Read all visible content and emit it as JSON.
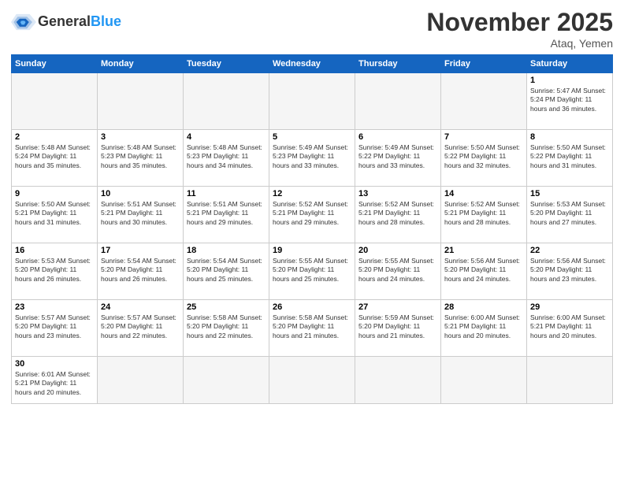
{
  "header": {
    "logo_general": "General",
    "logo_blue": "Blue",
    "month_title": "November 2025",
    "location": "Ataq, Yemen"
  },
  "days_of_week": [
    "Sunday",
    "Monday",
    "Tuesday",
    "Wednesday",
    "Thursday",
    "Friday",
    "Saturday"
  ],
  "weeks": [
    [
      {
        "day": "",
        "info": ""
      },
      {
        "day": "",
        "info": ""
      },
      {
        "day": "",
        "info": ""
      },
      {
        "day": "",
        "info": ""
      },
      {
        "day": "",
        "info": ""
      },
      {
        "day": "",
        "info": ""
      },
      {
        "day": "1",
        "info": "Sunrise: 5:47 AM\nSunset: 5:24 PM\nDaylight: 11 hours\nand 36 minutes."
      }
    ],
    [
      {
        "day": "2",
        "info": "Sunrise: 5:48 AM\nSunset: 5:24 PM\nDaylight: 11 hours\nand 35 minutes."
      },
      {
        "day": "3",
        "info": "Sunrise: 5:48 AM\nSunset: 5:23 PM\nDaylight: 11 hours\nand 35 minutes."
      },
      {
        "day": "4",
        "info": "Sunrise: 5:48 AM\nSunset: 5:23 PM\nDaylight: 11 hours\nand 34 minutes."
      },
      {
        "day": "5",
        "info": "Sunrise: 5:49 AM\nSunset: 5:23 PM\nDaylight: 11 hours\nand 33 minutes."
      },
      {
        "day": "6",
        "info": "Sunrise: 5:49 AM\nSunset: 5:22 PM\nDaylight: 11 hours\nand 33 minutes."
      },
      {
        "day": "7",
        "info": "Sunrise: 5:50 AM\nSunset: 5:22 PM\nDaylight: 11 hours\nand 32 minutes."
      },
      {
        "day": "8",
        "info": "Sunrise: 5:50 AM\nSunset: 5:22 PM\nDaylight: 11 hours\nand 31 minutes."
      }
    ],
    [
      {
        "day": "9",
        "info": "Sunrise: 5:50 AM\nSunset: 5:21 PM\nDaylight: 11 hours\nand 31 minutes."
      },
      {
        "day": "10",
        "info": "Sunrise: 5:51 AM\nSunset: 5:21 PM\nDaylight: 11 hours\nand 30 minutes."
      },
      {
        "day": "11",
        "info": "Sunrise: 5:51 AM\nSunset: 5:21 PM\nDaylight: 11 hours\nand 29 minutes."
      },
      {
        "day": "12",
        "info": "Sunrise: 5:52 AM\nSunset: 5:21 PM\nDaylight: 11 hours\nand 29 minutes."
      },
      {
        "day": "13",
        "info": "Sunrise: 5:52 AM\nSunset: 5:21 PM\nDaylight: 11 hours\nand 28 minutes."
      },
      {
        "day": "14",
        "info": "Sunrise: 5:52 AM\nSunset: 5:21 PM\nDaylight: 11 hours\nand 28 minutes."
      },
      {
        "day": "15",
        "info": "Sunrise: 5:53 AM\nSunset: 5:20 PM\nDaylight: 11 hours\nand 27 minutes."
      }
    ],
    [
      {
        "day": "16",
        "info": "Sunrise: 5:53 AM\nSunset: 5:20 PM\nDaylight: 11 hours\nand 26 minutes."
      },
      {
        "day": "17",
        "info": "Sunrise: 5:54 AM\nSunset: 5:20 PM\nDaylight: 11 hours\nand 26 minutes."
      },
      {
        "day": "18",
        "info": "Sunrise: 5:54 AM\nSunset: 5:20 PM\nDaylight: 11 hours\nand 25 minutes."
      },
      {
        "day": "19",
        "info": "Sunrise: 5:55 AM\nSunset: 5:20 PM\nDaylight: 11 hours\nand 25 minutes."
      },
      {
        "day": "20",
        "info": "Sunrise: 5:55 AM\nSunset: 5:20 PM\nDaylight: 11 hours\nand 24 minutes."
      },
      {
        "day": "21",
        "info": "Sunrise: 5:56 AM\nSunset: 5:20 PM\nDaylight: 11 hours\nand 24 minutes."
      },
      {
        "day": "22",
        "info": "Sunrise: 5:56 AM\nSunset: 5:20 PM\nDaylight: 11 hours\nand 23 minutes."
      }
    ],
    [
      {
        "day": "23",
        "info": "Sunrise: 5:57 AM\nSunset: 5:20 PM\nDaylight: 11 hours\nand 23 minutes."
      },
      {
        "day": "24",
        "info": "Sunrise: 5:57 AM\nSunset: 5:20 PM\nDaylight: 11 hours\nand 22 minutes."
      },
      {
        "day": "25",
        "info": "Sunrise: 5:58 AM\nSunset: 5:20 PM\nDaylight: 11 hours\nand 22 minutes."
      },
      {
        "day": "26",
        "info": "Sunrise: 5:58 AM\nSunset: 5:20 PM\nDaylight: 11 hours\nand 21 minutes."
      },
      {
        "day": "27",
        "info": "Sunrise: 5:59 AM\nSunset: 5:20 PM\nDaylight: 11 hours\nand 21 minutes."
      },
      {
        "day": "28",
        "info": "Sunrise: 6:00 AM\nSunset: 5:21 PM\nDaylight: 11 hours\nand 20 minutes."
      },
      {
        "day": "29",
        "info": "Sunrise: 6:00 AM\nSunset: 5:21 PM\nDaylight: 11 hours\nand 20 minutes."
      }
    ],
    [
      {
        "day": "30",
        "info": "Sunrise: 6:01 AM\nSunset: 5:21 PM\nDaylight: 11 hours\nand 20 minutes."
      },
      {
        "day": "",
        "info": ""
      },
      {
        "day": "",
        "info": ""
      },
      {
        "day": "",
        "info": ""
      },
      {
        "day": "",
        "info": ""
      },
      {
        "day": "",
        "info": ""
      },
      {
        "day": "",
        "info": ""
      }
    ]
  ]
}
